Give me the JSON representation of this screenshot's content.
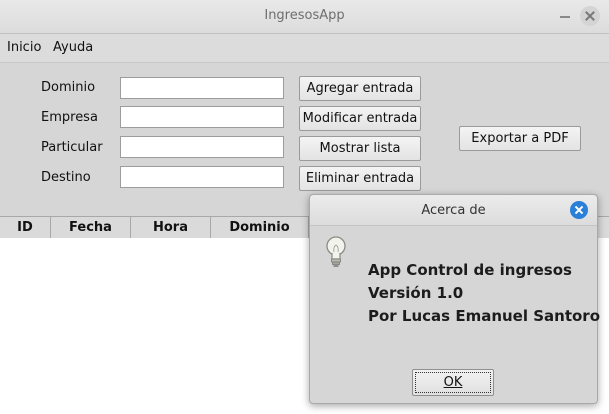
{
  "window": {
    "title": "IngresosApp"
  },
  "menu": {
    "items": [
      "Inicio",
      "Ayuda"
    ]
  },
  "form": {
    "fields": [
      {
        "label": "Dominio",
        "value": ""
      },
      {
        "label": "Empresa",
        "value": ""
      },
      {
        "label": "Particular",
        "value": ""
      },
      {
        "label": "Destino",
        "value": ""
      }
    ],
    "buttons": {
      "agregar": "Agregar entrada",
      "modificar": "Modificar entrada",
      "mostrar": "Mostrar lista",
      "eliminar": "Eliminar entrada",
      "exportar": "Exportar a PDF"
    }
  },
  "table": {
    "columns": [
      "ID",
      "Fecha",
      "Hora",
      "Dominio"
    ]
  },
  "dialog": {
    "title": "Acerca de",
    "lines": [
      "App Control de ingresos",
      "Versión 1.0",
      "Por Lucas Emanuel Santoro"
    ],
    "ok_label": "OK",
    "icon": "lightbulb-icon",
    "close_color": "#2a7fd9"
  }
}
